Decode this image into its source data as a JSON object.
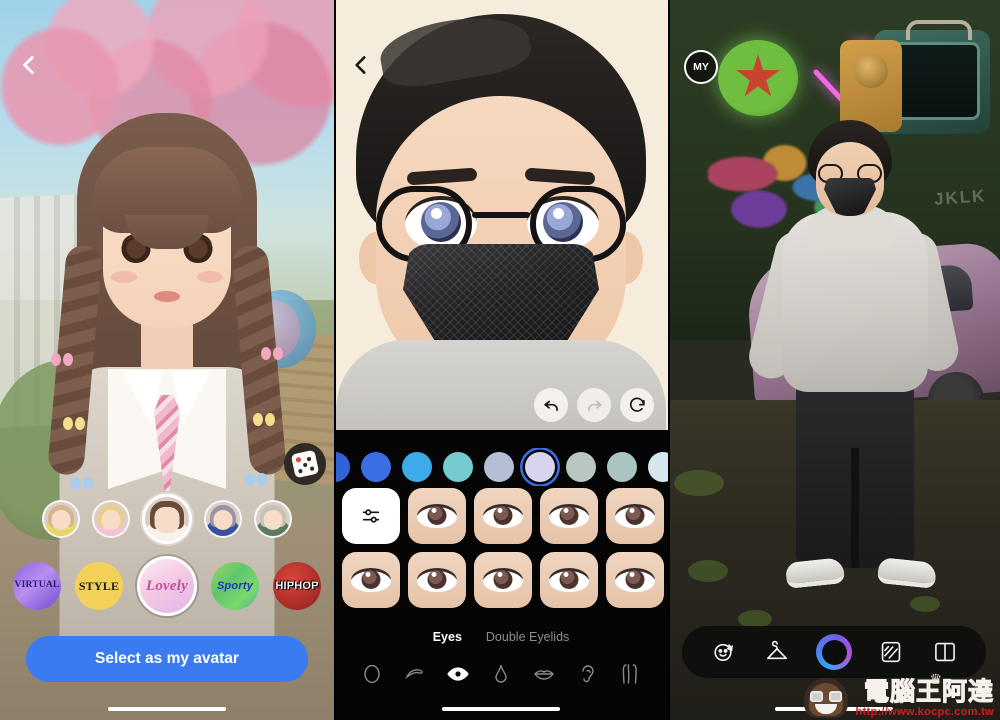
{
  "panels": {
    "avatar_pick": {
      "name": "avatar-selection-screen",
      "back_icon": "chevron-left-icon",
      "randomize_icon": "dice-icon",
      "thumbnails": [
        {
          "label": "avatar-option-1",
          "hair": "#d8b48c",
          "body": "#e7d76a"
        },
        {
          "label": "avatar-option-2",
          "hair": "#e9cf86",
          "body": "#f3c3d4"
        },
        {
          "label": "avatar-option-3",
          "hair": "#6b4a38",
          "body": "#f7f3ec",
          "selected": true
        },
        {
          "label": "avatar-option-4",
          "hair": "#9b93a8",
          "body": "#3a4f9e"
        },
        {
          "label": "avatar-option-5",
          "hair": "#c8c2b6",
          "body": "#5d7a5e"
        }
      ],
      "styles": [
        {
          "label": "VIRTUAL",
          "selected": false
        },
        {
          "label": "STYLE",
          "selected": false
        },
        {
          "label": "Lovely",
          "selected": true
        },
        {
          "label": "Sporty",
          "selected": false
        },
        {
          "label": "HIPHOP",
          "selected": false
        }
      ],
      "cta_label": "Select as my avatar",
      "cta_color": "#3b7bf2"
    },
    "editor": {
      "name": "avatar-editor-screen",
      "back_icon": "chevron-left-icon",
      "history": [
        {
          "icon": "undo-icon",
          "enabled": true
        },
        {
          "icon": "redo-icon",
          "enabled": false
        },
        {
          "icon": "reset-icon",
          "enabled": true
        }
      ],
      "color_swatches": [
        {
          "hex": "#2f63d8",
          "selected": false
        },
        {
          "hex": "#3a6fe3",
          "selected": false
        },
        {
          "hex": "#3cabe8",
          "selected": false
        },
        {
          "hex": "#74cbd2",
          "selected": false
        },
        {
          "hex": "#b6bed6",
          "selected": false
        },
        {
          "hex": "#d8d3ee",
          "selected": true
        },
        {
          "hex": "#b9c7c0",
          "selected": false
        },
        {
          "hex": "#a9c4c1",
          "selected": false
        },
        {
          "hex": "#d6e6ee",
          "selected": false
        },
        {
          "hex": "#cfe1e8",
          "selected": false
        }
      ],
      "grid_adjust_icon": "sliders-icon",
      "eye_options_count": 9,
      "subtabs": [
        {
          "label": "Eyes",
          "active": true
        },
        {
          "label": "Double Eyelids",
          "active": false
        }
      ],
      "feature_icons": [
        {
          "name": "face-shape-icon",
          "active": false
        },
        {
          "name": "eyebrow-icon",
          "active": false
        },
        {
          "name": "eye-icon",
          "active": true
        },
        {
          "name": "nose-icon",
          "active": false
        },
        {
          "name": "lips-icon",
          "active": false
        },
        {
          "name": "ear-icon",
          "active": false
        },
        {
          "name": "body-icon",
          "active": false
        }
      ]
    },
    "world": {
      "name": "world-screen",
      "my_button_label": "MY",
      "dock": [
        {
          "name": "emoji-face-icon",
          "active": false
        },
        {
          "name": "hanger-wardrobe-icon",
          "active": false
        },
        {
          "name": "camera-ring-icon",
          "active": true
        },
        {
          "name": "mirror-icon",
          "active": false
        },
        {
          "name": "book-feed-icon",
          "active": false
        }
      ],
      "graffiti_text": "JKLK"
    }
  },
  "watermark": {
    "title": "電腦王阿達",
    "url": "http://www.kocpc.com.tw",
    "crown_icon": "crown-icon"
  }
}
